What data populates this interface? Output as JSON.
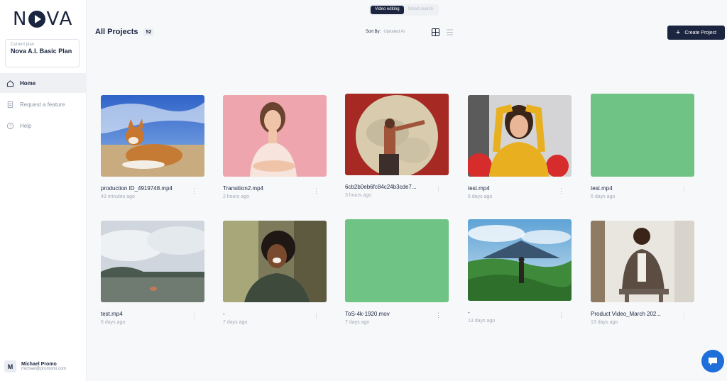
{
  "brand": {
    "logo_prefix": "N",
    "logo_suffix": "VA"
  },
  "plan": {
    "label": "Current plan",
    "name": "Nova A.I. Basic Plan"
  },
  "nav": [
    {
      "label": "Home",
      "icon": "home-icon",
      "active": true
    },
    {
      "label": "Request a feature",
      "icon": "document-icon",
      "active": false
    },
    {
      "label": "Help",
      "icon": "help-icon",
      "active": false
    }
  ],
  "user": {
    "initial": "M",
    "name": "Michael Promo",
    "email": "michael@promomi.com"
  },
  "mode_toggle": {
    "options": [
      "Video editing",
      "Smart search"
    ],
    "selected": "Video editing"
  },
  "header": {
    "title": "All Projects",
    "count": "52",
    "sort_label": "Sort By:",
    "sort_value": "Updated At",
    "create_label": "Create Project"
  },
  "projects": [
    {
      "title": "production ID_4919748.mp4",
      "time": "43 minutes ago",
      "thumb": "corgi-beach"
    },
    {
      "title": "Transition2.mp4",
      "time": "2 hours ago",
      "thumb": "woman-pink"
    },
    {
      "title": "6cb2b0eb6fc84c24b3cde7...",
      "time": "3 hours ago",
      "thumb": "man-circle"
    },
    {
      "title": "test.mp4",
      "time": "6 days ago",
      "thumb": "woman-yellow"
    },
    {
      "title": "test.mp4",
      "time": "6 days ago",
      "thumb": "green"
    },
    {
      "title": "test.mp4",
      "time": "6 days ago",
      "thumb": "lake"
    },
    {
      "title": "-",
      "time": "7 days ago",
      "thumb": "laughing-woman"
    },
    {
      "title": "ToS-4k-1920.mov",
      "time": "7 days ago",
      "thumb": "green"
    },
    {
      "title": "-",
      "time": "13 days ago",
      "thumb": "mountain"
    },
    {
      "title": "Product Video_March 202...",
      "time": "13 days ago",
      "thumb": "businessman"
    }
  ],
  "colors": {
    "primary": "#1b2540",
    "placeholder_green": "#6fc385",
    "chat": "#1e6fd9"
  }
}
